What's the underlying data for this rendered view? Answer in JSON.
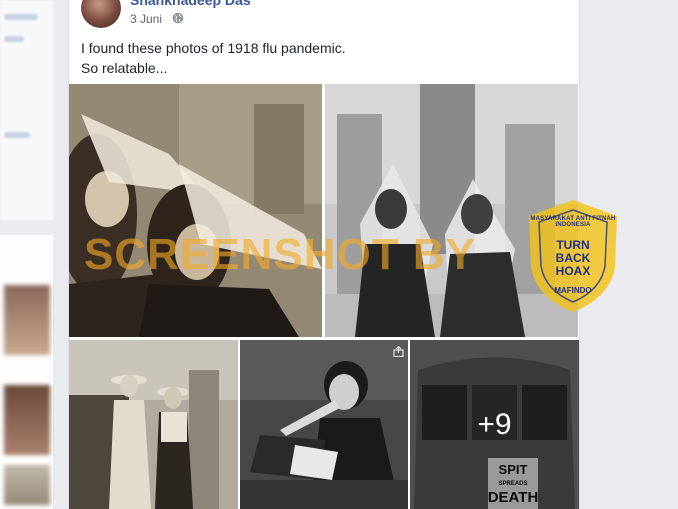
{
  "post": {
    "author": "Shankhadeep Das",
    "date": "3 Juni",
    "text_line1": "I found these photos of 1918 flu pandemic.",
    "text_line2": "So relatable...",
    "more_photos": "+9",
    "privacy_icon": "globe-icon"
  },
  "photos": {
    "sign_line1": "SPIT",
    "sign_line2": "SPREADS",
    "sign_line3": "DEATH"
  },
  "watermark": {
    "text": "SCREENSHOT BY"
  },
  "badge": {
    "line1": "TURN",
    "line2": "BACK",
    "line3": "HOAX",
    "arc_top": "MASYARAKAT ANTI FITNAH INDONESIA",
    "arc_bottom": "MAFINDO"
  },
  "colors": {
    "author_link": "#385898",
    "watermark": "#f2aa28",
    "badge_yellow": "#f3c21a",
    "badge_blue": "#1c2f87"
  }
}
